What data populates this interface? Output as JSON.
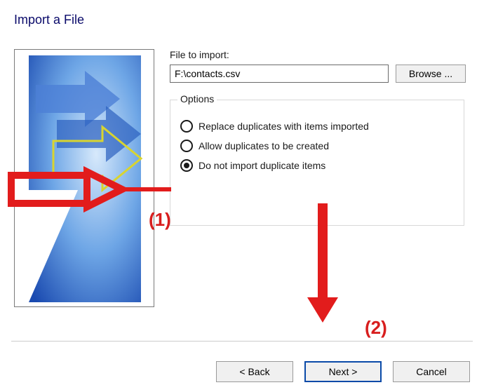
{
  "title": "Import a File",
  "file": {
    "label": "File to import:",
    "value": "F:\\contacts.csv",
    "browse_label": "Browse ..."
  },
  "options": {
    "legend": "Options",
    "items": [
      {
        "label": "Replace duplicates with items imported",
        "selected": false
      },
      {
        "label": "Allow duplicates to be created",
        "selected": false
      },
      {
        "label": "Do not import duplicate items",
        "selected": true
      }
    ]
  },
  "buttons": {
    "back": "< Back",
    "next": "Next >",
    "cancel": "Cancel"
  },
  "annotations": {
    "marker1": "(1)",
    "marker2": "(2)"
  }
}
